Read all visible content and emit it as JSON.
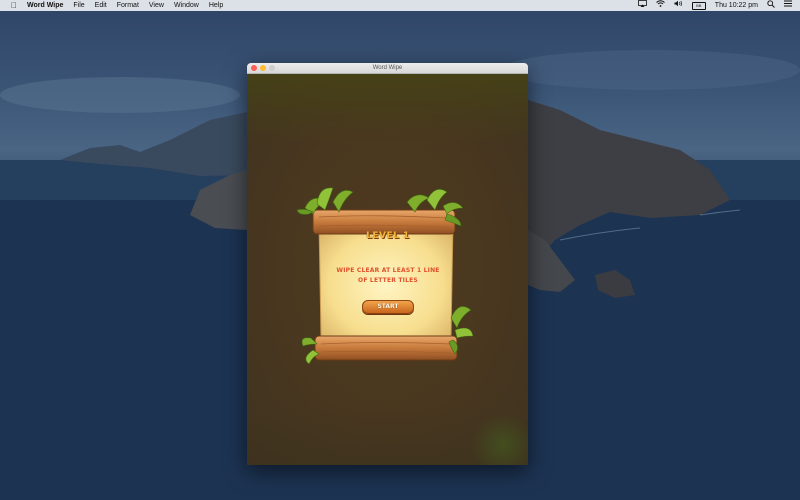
{
  "menubar": {
    "apple_icon": "apple-icon",
    "app_name": "Word Wipe",
    "menus": [
      "File",
      "Edit",
      "Format",
      "View",
      "Window",
      "Help"
    ],
    "status": {
      "battery_label": "BB",
      "datetime": "Thu 10:22 pm",
      "icons": [
        "airplay-icon",
        "wifi-icon",
        "volume-icon",
        "battery-icon",
        "search-icon",
        "list-icon"
      ]
    }
  },
  "window": {
    "title": "Word Wipe"
  },
  "game": {
    "level_title": "LEVEL 1",
    "instruction": "WIPE CLEAR AT LEAST 1 LINE OF LETTER TILES",
    "start_label": "START"
  },
  "colors": {
    "game_background": "#49371f",
    "title_text": "#f3b63a",
    "instruction_text": "#e0502a",
    "button": "#e0872e"
  }
}
